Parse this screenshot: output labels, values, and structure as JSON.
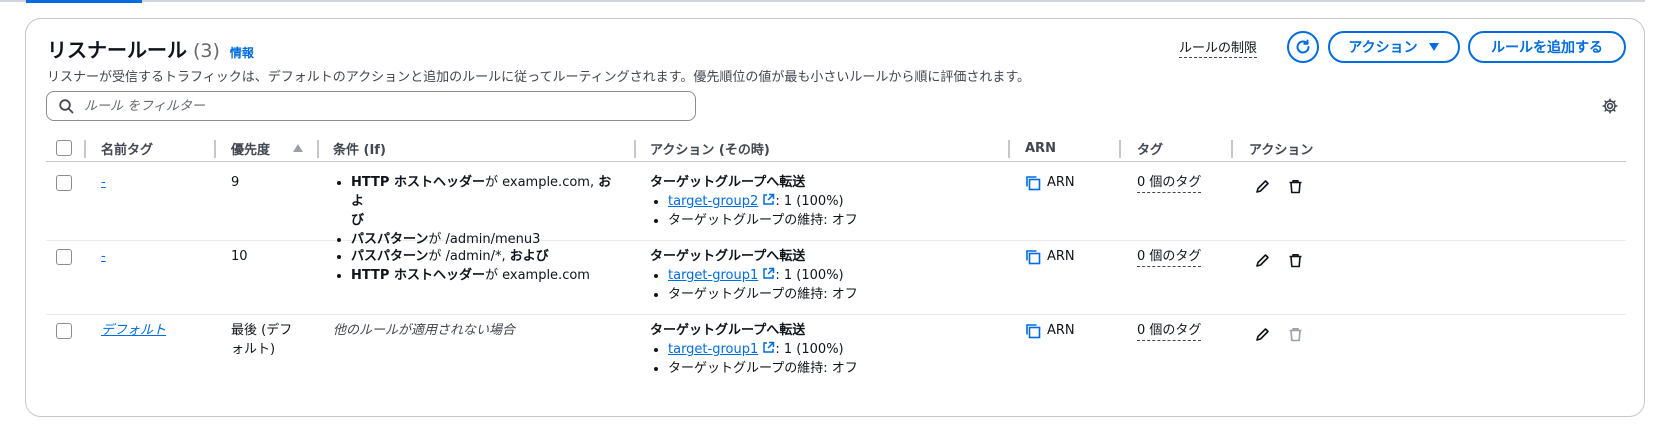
{
  "header": {
    "title": "リスナールール",
    "count": "(3)",
    "info_link": "情報",
    "description": "リスナーが受信するトラフィックは、デフォルトのアクションと追加のルールに従ってルーティングされます。優先順位の値が最も小さいルールから順に評価されます。",
    "limits_link": "ルールの制限",
    "actions_button": "アクション",
    "add_rule_button": "ルールを追加する"
  },
  "filter": {
    "placeholder": "ルール をフィルター"
  },
  "columns": {
    "name_tag": "名前タグ",
    "priority": "優先度",
    "condition": "条件 (If)",
    "action": "アクション (その時)",
    "arn": "ARN",
    "tags": "タグ",
    "actions": "アクション"
  },
  "rows": [
    {
      "name": "-",
      "priority": "9",
      "conditions": [
        {
          "key": "HTTP ホストヘッダー",
          "rest": "が example.com, ",
          "suffix": "およ",
          "line2": "び"
        },
        {
          "key": "パスパターン",
          "rest": "が /admin/menu3"
        }
      ],
      "action_title": "ターゲットグループへ転送",
      "target_group": "target-group2",
      "target_weight": ": 1 (100%)",
      "stickiness": "ターゲットグループの維持: オフ",
      "arn_label": "ARN",
      "tags": "0 個のタグ"
    },
    {
      "name": "-",
      "priority": "10",
      "conditions": [
        {
          "key": "パスパターン",
          "rest": "が /admin/*, ",
          "suffix": "および"
        },
        {
          "key": "HTTP ホストヘッダー",
          "rest": "が example.com"
        }
      ],
      "action_title": "ターゲットグループへ転送",
      "target_group": "target-group1",
      "target_weight": ": 1 (100%)",
      "stickiness": "ターゲットグループの維持: オフ",
      "arn_label": "ARN",
      "tags": "0 個のタグ"
    },
    {
      "name": "デフォルト",
      "priority_line1": "最後 (デフ",
      "priority_line2": "ォルト)",
      "condition_text": "他のルールが適用されない場合",
      "action_title": "ターゲットグループへ転送",
      "target_group": "target-group1",
      "target_weight": ": 1 (100%)",
      "stickiness": "ターゲットグループの維持: オフ",
      "arn_label": "ARN",
      "tags": "0 個のタグ"
    }
  ],
  "colors": {
    "accent": "#006ce0",
    "border": "#c6c6cd",
    "text": "#0f141a",
    "muted": "#424650"
  }
}
